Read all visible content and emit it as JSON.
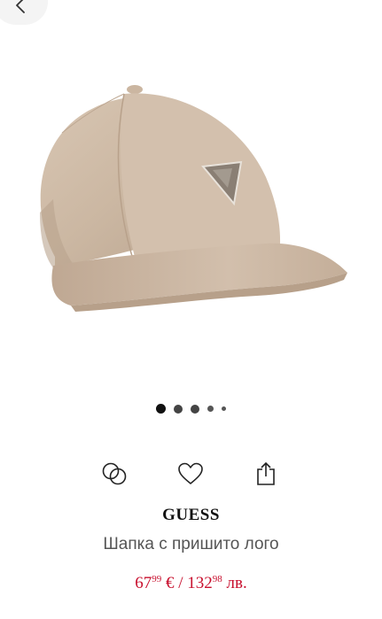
{
  "nav": {
    "back_icon": "chevron-left-icon"
  },
  "gallery": {
    "image_count": 5,
    "active_index": 0,
    "image_alt": "beige baseball cap with triangle logo"
  },
  "actions": [
    {
      "icon": "compare-icon"
    },
    {
      "icon": "heart-icon"
    },
    {
      "icon": "share-icon"
    }
  ],
  "product": {
    "brand": "GUESS",
    "name": "Шапка с пришито лого",
    "price_eur_main": "67",
    "price_eur_cents": "99",
    "price_eur_symbol": " € / ",
    "price_bgn_main": "132",
    "price_bgn_cents": "98",
    "price_bgn_symbol": " лв."
  },
  "colors": {
    "price": "#c8102e",
    "cap": "#cdb8a3",
    "background": "#ffffff"
  }
}
